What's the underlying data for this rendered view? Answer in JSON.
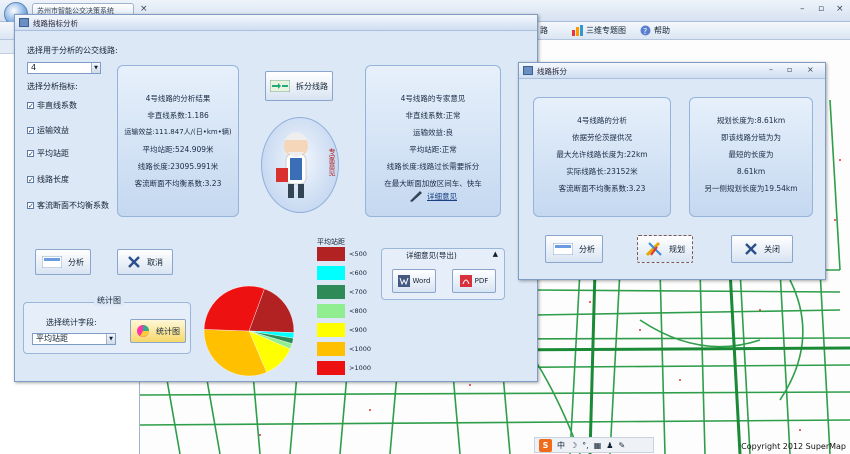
{
  "app": {
    "tab_title": "苏州市智能公交决策系统",
    "ribbon_items": [
      {
        "label": "路",
        "icon": "bus-icon"
      },
      {
        "label": "三维专题图",
        "icon": "bar-chart-icon"
      },
      {
        "label": "帮助",
        "icon": "help-icon"
      }
    ]
  },
  "map": {
    "copyright": "Copyright 2012 SuperMap"
  },
  "taskbar": {
    "logo": "S",
    "items": [
      "中",
      "☽",
      "°,",
      "▦",
      "♟",
      "✎"
    ]
  },
  "dialog_analysis": {
    "title": "线路指标分析",
    "route_prompt": "选择用于分析的公交线路:",
    "route_value": "4",
    "indicator_prompt": "选择分析指标:",
    "indicators": [
      {
        "label": "非直线系数",
        "checked": true
      },
      {
        "label": "运输效益",
        "checked": true
      },
      {
        "label": "平均站距",
        "checked": true
      },
      {
        "label": "线路长度",
        "checked": true
      },
      {
        "label": "客流断面不均衡系数",
        "checked": true
      }
    ],
    "result_lines": [
      "4号线路的分析结果",
      "非直线系数:1.186",
      "运输效益:111.847人/(日•km•辆)",
      "平均站距:524.909米",
      "线路长度:23095.991米",
      "客流断面不均衡系数:3.23"
    ],
    "split_button": "拆分线路",
    "expert_label": "专家意见",
    "expert_lines": [
      "4号线路的专家意见",
      "非直线系数:正常",
      "运输效益:良",
      "平均站距:正常",
      "线路长度:线路过长需要拆分",
      "在最大断面加放区间车、快车"
    ],
    "detail_link": "详细意见",
    "analyze_button": "分析",
    "cancel_button": "取消",
    "stats_group_title": "统计图",
    "stats_field_prompt": "选择统计字段:",
    "stats_field_value": "平均站距",
    "stats_button": "统计图",
    "export_group_title": "详细意见(导出)",
    "export_word": "Word",
    "export_pdf": "PDF",
    "legend_title": "平均站距",
    "legend": [
      {
        "label": "<500",
        "color": "#b22222"
      },
      {
        "label": "<600",
        "color": "#00ffff"
      },
      {
        "label": "<700",
        "color": "#2e8b57"
      },
      {
        "label": "<800",
        "color": "#90ee90"
      },
      {
        "label": "<900",
        "color": "#ffff00"
      },
      {
        "label": "<1000",
        "color": "#ffc000"
      },
      {
        "label": ">1000",
        "color": "#ee1111"
      }
    ]
  },
  "chart_data": {
    "type": "pie",
    "title": "",
    "slices": [
      {
        "label": "<500",
        "value": 20,
        "color": "#b22222"
      },
      {
        "label": "<600",
        "value": 2,
        "color": "#00ffff"
      },
      {
        "label": "<700",
        "value": 2,
        "color": "#2e8b57"
      },
      {
        "label": "<800",
        "value": 2,
        "color": "#90ee90"
      },
      {
        "label": "<900",
        "value": 12,
        "color": "#ffff00"
      },
      {
        "label": "<1000",
        "value": 32,
        "color": "#ffc000"
      },
      {
        "label": ">1000",
        "value": 30,
        "color": "#ee1111"
      }
    ]
  },
  "dialog_split": {
    "title": "线路拆分",
    "left_lines": [
      "4号线路的分析",
      "依据劳伦茨提供况",
      "最大允许线路长度为:22km",
      "实际线路长:23152米",
      "客流断面不均衡系数:3.23"
    ],
    "right_lines": [
      "规划长度为:8.61km",
      "即该线路分链为为",
      "最短的长度为",
      "8.61km",
      "另一侧规划长度为19.54km"
    ],
    "analyze_button": "分析",
    "plan_button": "规划",
    "close_button": "关闭"
  }
}
